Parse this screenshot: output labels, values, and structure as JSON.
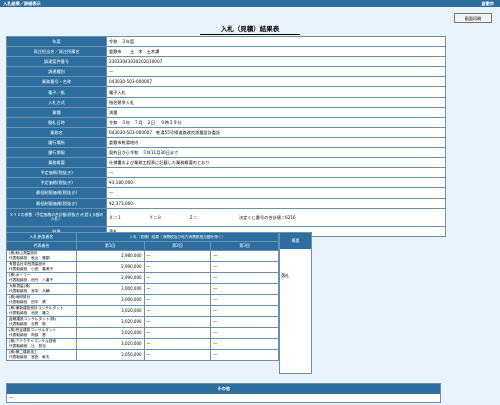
{
  "topbar": {
    "left": "入札結果／詳細表示",
    "right": "倉敷市"
  },
  "print_button": "画面印刷",
  "page_title": "入札（見積）結果表",
  "details": [
    {
      "key": "年度",
      "value": "令和　３年度"
    },
    {
      "key": "発注担当名／発注所属名",
      "value": "倉敷市　　土　木　土木課"
    },
    {
      "key": "調達案件番号",
      "value": "23033043030202010007"
    },
    {
      "key": "調達種別",
      "value": "―"
    },
    {
      "key": "業務番号・名称",
      "value": "043030-503-000007"
    },
    {
      "key": "電子／紙",
      "value": "電子入札"
    },
    {
      "key": "入札方式",
      "value": "指名競争入札"
    },
    {
      "key": "業種",
      "value": "測量"
    },
    {
      "key": "開札日時",
      "value": "令和　３年　７月　２日　 ９時３９分"
    },
    {
      "key": "業務名",
      "value": "043030-503-000007　乾湯55号線道路改良測量設計委託"
    },
    {
      "key": "履行場所",
      "value": "倉敷市乾湯地内"
    },
    {
      "key": "履行期限",
      "value": "契約日から令和　３年11月30日まで"
    },
    {
      "key": "業務概要",
      "value": "仕様書および業務工程表に記載した業務概要のとおり"
    },
    {
      "key": "予定価格(税抜き)",
      "value": "―"
    },
    {
      "key": "予定価格(税抜き)",
      "value": "¥3,180,000-"
    },
    {
      "key": "最低制限価格(税抜き)",
      "value": "―"
    },
    {
      "key": "最低制限価格(税抜き)",
      "value": "¥2,373,000-"
    }
  ],
  "formula": {
    "key": "ＸＹＺの係数（予定価格の合計額(税抜き)を超える額の入札）",
    "x": "Ｘ＝１",
    "y": "Ｙ＝８",
    "z": "Ｚ＝",
    "note": "決定くじ番号の合計値＝6216"
  },
  "result": {
    "key": "結果",
    "value": "落札"
  },
  "bid_header": {
    "bidder": "入札参加者名",
    "rep": "代表者名",
    "amount_group": "入札（見積）結果（消費税及び地方消費税相当額を除く）",
    "round1": "第1回",
    "round2": "第2回",
    "round3": "第3回",
    "remarks": "摘要"
  },
  "bidders": [
    {
      "name": "(株)秋山測量設計",
      "rep": "代表取締役　秋山　雅嗣",
      "r1": "2,980,000",
      "r2": "―",
      "r3": "―"
    },
    {
      "name": "有限会社中西測量設計",
      "rep": "代表取締役　小田　喜美子",
      "r1": "2,990,000",
      "r2": "―",
      "r3": "―"
    },
    {
      "name": "(株)ボーコー",
      "rep": "代表取締役　田代　八重子",
      "r1": "2,990,000",
      "r2": "―",
      "r3": "―"
    },
    {
      "name": "大和測量(株)",
      "rep": "代表取締役　宮本　大輔",
      "r1": "3,000,000",
      "r2": "―",
      "r3": "―"
    },
    {
      "name": "(株)地研設計",
      "rep": "代表取締役　田中　健",
      "r1": "3,000,000",
      "r2": "―",
      "r3": "―"
    },
    {
      "name": "(株)東新建設設計コンサルタント",
      "rep": "代表取締役　池田　隆之",
      "r1": "3,020,000",
      "r2": "―",
      "r3": "―"
    },
    {
      "name": "倉敷建設コンサルタント(株)",
      "rep": "代表取締役　吉野　毅",
      "r1": "3,020,000",
      "r2": "―",
      "r3": "―"
    },
    {
      "name": "(株)荒谷建設コンサルタント",
      "rep": "代表取締役　阿部　晋",
      "r1": "3,020,000",
      "r2": "―",
      "r3": "―"
    },
    {
      "name": "(株)アテクチャコンサル技術",
      "rep": "代表取締役　辻　哲也",
      "r1": "3,020,000",
      "r2": "―",
      "r3": "―"
    },
    {
      "name": "(株)第二建設技工",
      "rep": "代表取締役　宮田　幹夫",
      "r1": "3,050,000",
      "r2": "―",
      "r3": "―"
    }
  ],
  "remarks_value": "落札",
  "other": {
    "header": "その他",
    "body": "―"
  }
}
